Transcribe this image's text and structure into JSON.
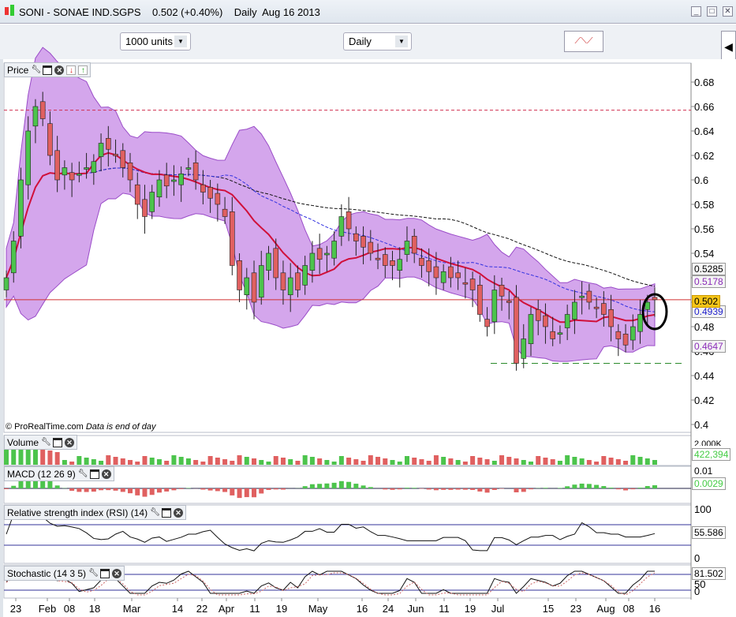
{
  "window": {
    "title": "SONI - SONAE IND.SGPS    0.502 (+0.40%)    Daily  Aug 16 2013",
    "buttons": [
      "_",
      "□",
      "✕"
    ]
  },
  "toolbar": {
    "units": "1000 units",
    "period": "Daily"
  },
  "panels": {
    "price": {
      "label": "Price",
      "credit": "© ProRealTime.com",
      "credit_note": "Data is end of day"
    },
    "volume": {
      "label": "Volume",
      "axis": "2,000K",
      "value": "422,394"
    },
    "macd": {
      "label": "MACD (12 26 9)",
      "axis": "0.01",
      "value": "0.0029"
    },
    "rsi": {
      "label": "Relative strength index (RSI) (14)",
      "axis_top": "100",
      "axis_bottom": "0",
      "value": "55.586"
    },
    "stoch": {
      "label": "Stochastic (14 3 5)",
      "axis_mid": "50",
      "axis_bottom": "0",
      "value": "81.502"
    }
  },
  "price_tags": {
    "black_ma": "0.5285",
    "bb_upper": "0.5178",
    "last": "0.502",
    "blue_ma": "0.4939",
    "bb_lower": "0.4647"
  },
  "colors": {
    "bb_fill": "#d4a6ec",
    "bb_line": "#9a4cc8",
    "ma_red": "#d0103a",
    "ma_blue": "#3030e0",
    "up": "#4cc44c",
    "down": "#e06060",
    "accent": "#f5c518"
  },
  "chart_data": {
    "type": "candlestick",
    "title": "SONI - SONAE IND.SGPS Daily",
    "ylim": [
      0.395,
      0.69
    ],
    "yticks": [
      0.4,
      0.42,
      0.44,
      0.46,
      0.48,
      0.5,
      0.52,
      0.54,
      0.56,
      0.58,
      0.6,
      0.62,
      0.64,
      0.66,
      0.68
    ],
    "xticks": [
      "23",
      "Feb",
      "08",
      "18",
      "Mar",
      "14",
      "22",
      "Apr",
      "11",
      "19",
      "May",
      "16",
      "24",
      "Jun",
      "11",
      "19",
      "Jul",
      "15",
      "23",
      "Aug",
      "08",
      "16"
    ],
    "resistance": 0.657,
    "support": 0.45,
    "last_price": 0.502,
    "close": [
      0.52,
      0.55,
      0.6,
      0.64,
      0.66,
      0.65,
      0.62,
      0.6,
      0.61,
      0.6,
      0.605,
      0.61,
      0.615,
      0.63,
      0.625,
      0.62,
      0.61,
      0.6,
      0.58,
      0.57,
      0.59,
      0.6,
      0.595,
      0.6,
      0.605,
      0.61,
      0.6,
      0.59,
      0.585,
      0.58,
      0.57,
      0.53,
      0.51,
      0.52,
      0.5,
      0.53,
      0.54,
      0.52,
      0.51,
      0.52,
      0.51,
      0.53,
      0.54,
      0.535,
      0.54,
      0.55,
      0.57,
      0.56,
      0.55,
      0.545,
      0.54,
      0.535,
      0.53,
      0.53,
      0.535,
      0.55,
      0.54,
      0.53,
      0.525,
      0.52,
      0.525,
      0.52,
      0.52,
      0.515,
      0.51,
      0.49,
      0.48,
      0.51,
      0.505,
      0.5,
      0.45,
      0.47,
      0.49,
      0.485,
      0.48,
      0.47,
      0.475,
      0.49,
      0.5,
      0.505,
      0.5,
      0.495,
      0.49,
      0.48,
      0.47,
      0.465,
      0.48,
      0.49,
      0.5,
      0.502
    ]
  }
}
